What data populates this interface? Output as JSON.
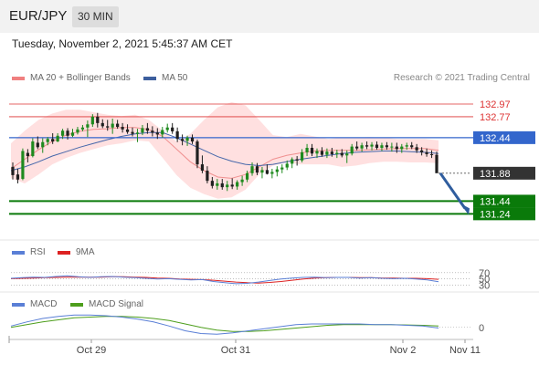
{
  "header": {
    "pair": "EUR/JPY",
    "timeframe": "30 MIN"
  },
  "datetime": "Tuesday, November 2, 2021 5:45:37 AM CET",
  "legend": {
    "ma": "MA 20 + Bollinger Bands",
    "ma50": "MA 50",
    "credit": "Research © 2021 Trading Central"
  },
  "rsi_legend": {
    "rsi": "RSI",
    "ma": "9MA"
  },
  "macd_legend": {
    "macd": "MACD",
    "signal": "MACD Signal"
  },
  "colors": {
    "bullish": "#1e8a1e",
    "bearish": "#1f1f1f",
    "resistance": "#dd3333",
    "support": "#0a7a0a",
    "ma50": "#4466aa",
    "band": "#ffd5d5",
    "pivot": "#3366cc",
    "current": "#333333",
    "arrow": "#2f5d9e"
  },
  "chart_data": {
    "type": "candlestick",
    "ylim": [
      130.9,
      133.2
    ],
    "levels": [
      {
        "value": 132.97,
        "label": "132.97",
        "kind": "resistance"
      },
      {
        "value": 132.77,
        "label": "132.77",
        "kind": "resistance"
      },
      {
        "value": 132.44,
        "label": "132.44",
        "kind": "pivot"
      },
      {
        "value": 131.88,
        "label": "131.88",
        "kind": "current"
      },
      {
        "value": 131.44,
        "label": "131.44",
        "kind": "support"
      },
      {
        "value": 131.24,
        "label": "131.24",
        "kind": "support"
      }
    ],
    "x_ticks": [
      "Oct 29",
      "Oct 31",
      "Nov 2",
      "Nov 11"
    ],
    "rsi_levels": [
      "70",
      "50",
      "30"
    ],
    "macd_levels": [
      "0"
    ],
    "candles": [
      [
        131.98,
        132.05,
        131.78,
        131.85
      ],
      [
        131.86,
        131.95,
        131.72,
        131.78
      ],
      [
        131.79,
        132.27,
        131.77,
        132.23
      ],
      [
        132.2,
        132.26,
        132.05,
        132.15
      ],
      [
        132.15,
        132.43,
        132.13,
        132.38
      ],
      [
        132.36,
        132.46,
        132.26,
        132.29
      ],
      [
        132.29,
        132.43,
        132.2,
        132.37
      ],
      [
        132.37,
        132.45,
        132.32,
        132.42
      ],
      [
        132.42,
        132.51,
        132.34,
        132.38
      ],
      [
        132.38,
        132.51,
        132.37,
        132.47
      ],
      [
        132.47,
        132.58,
        132.42,
        132.55
      ],
      [
        132.55,
        132.59,
        132.41,
        132.47
      ],
      [
        132.47,
        132.58,
        132.45,
        132.52
      ],
      [
        132.52,
        132.61,
        132.49,
        132.57
      ],
      [
        132.57,
        132.64,
        132.54,
        132.6
      ],
      [
        132.6,
        132.71,
        132.45,
        132.65
      ],
      [
        132.65,
        132.81,
        132.61,
        132.77
      ],
      [
        132.77,
        132.83,
        132.6,
        132.67
      ],
      [
        132.67,
        132.73,
        132.59,
        132.62
      ],
      [
        132.62,
        132.72,
        132.55,
        132.6
      ],
      [
        132.6,
        132.74,
        132.5,
        132.66
      ],
      [
        132.66,
        132.72,
        132.58,
        132.61
      ],
      [
        132.61,
        132.67,
        132.52,
        132.57
      ],
      [
        132.57,
        132.65,
        132.5,
        132.53
      ],
      [
        132.53,
        132.6,
        132.46,
        132.5
      ],
      [
        132.5,
        132.58,
        132.37,
        132.52
      ],
      [
        132.52,
        132.64,
        132.48,
        132.59
      ],
      [
        132.59,
        132.67,
        132.5,
        132.55
      ],
      [
        132.55,
        132.62,
        132.46,
        132.52
      ],
      [
        132.52,
        132.59,
        132.42,
        132.49
      ],
      [
        132.49,
        132.61,
        132.44,
        132.56
      ],
      [
        132.56,
        132.66,
        132.52,
        132.6
      ],
      [
        132.6,
        132.67,
        132.5,
        132.54
      ],
      [
        132.54,
        132.6,
        132.37,
        132.42
      ],
      [
        132.42,
        132.49,
        132.32,
        132.39
      ],
      [
        132.39,
        132.47,
        132.31,
        132.44
      ],
      [
        132.44,
        132.49,
        132.34,
        132.38
      ],
      [
        132.38,
        132.41,
        131.96,
        132.02
      ],
      [
        132.02,
        132.16,
        131.88,
        131.92
      ],
      [
        131.92,
        131.99,
        131.72,
        131.76
      ],
      [
        131.76,
        131.82,
        131.64,
        131.68
      ],
      [
        131.68,
        131.79,
        131.62,
        131.72
      ],
      [
        131.72,
        131.79,
        131.62,
        131.66
      ],
      [
        131.66,
        131.76,
        131.6,
        131.7
      ],
      [
        131.7,
        131.8,
        131.63,
        131.67
      ],
      [
        131.67,
        131.77,
        131.62,
        131.74
      ],
      [
        131.74,
        131.84,
        131.68,
        131.78
      ],
      [
        131.78,
        131.92,
        131.74,
        131.88
      ],
      [
        131.88,
        132.05,
        131.84,
        131.99
      ],
      [
        131.99,
        132.04,
        131.85,
        131.89
      ],
      [
        131.89,
        131.98,
        131.8,
        131.93
      ],
      [
        131.93,
        132.02,
        131.86,
        131.87
      ],
      [
        131.87,
        131.95,
        131.8,
        131.9
      ],
      [
        131.9,
        131.99,
        131.83,
        131.94
      ],
      [
        131.94,
        132.02,
        131.88,
        131.97
      ],
      [
        131.97,
        132.08,
        131.93,
        132.03
      ],
      [
        132.03,
        132.13,
        131.96,
        132.1
      ],
      [
        132.1,
        132.15,
        132.0,
        132.08
      ],
      [
        132.08,
        132.26,
        132.05,
        132.21
      ],
      [
        132.21,
        132.34,
        132.15,
        132.28
      ],
      [
        132.28,
        132.34,
        132.15,
        132.19
      ],
      [
        132.19,
        132.27,
        132.12,
        132.23
      ],
      [
        132.23,
        132.29,
        132.14,
        132.17
      ],
      [
        132.17,
        132.27,
        132.12,
        132.22
      ],
      [
        132.22,
        132.28,
        132.14,
        132.18
      ],
      [
        132.18,
        132.25,
        132.12,
        132.2
      ],
      [
        132.2,
        132.26,
        132.13,
        132.16
      ],
      [
        132.16,
        132.24,
        132.04,
        132.19
      ],
      [
        132.19,
        132.34,
        132.16,
        132.3
      ],
      [
        132.3,
        132.38,
        132.24,
        132.27
      ],
      [
        132.27,
        132.36,
        132.22,
        132.32
      ],
      [
        132.32,
        132.38,
        132.26,
        132.3
      ],
      [
        132.3,
        132.37,
        132.24,
        132.33
      ],
      [
        132.33,
        132.38,
        132.25,
        132.28
      ],
      [
        132.28,
        132.36,
        132.23,
        132.32
      ],
      [
        132.32,
        132.37,
        132.25,
        132.29
      ],
      [
        132.29,
        132.36,
        132.22,
        132.3
      ],
      [
        132.3,
        132.36,
        132.2,
        132.26
      ],
      [
        132.26,
        132.34,
        132.2,
        132.3
      ],
      [
        132.3,
        132.36,
        132.25,
        132.32
      ],
      [
        132.32,
        132.37,
        132.26,
        132.29
      ],
      [
        132.29,
        132.34,
        132.2,
        132.24
      ],
      [
        132.24,
        132.29,
        132.16,
        132.21
      ],
      [
        132.21,
        132.27,
        132.14,
        132.18
      ],
      [
        132.18,
        132.24,
        132.12,
        132.17
      ],
      [
        132.17,
        132.22,
        131.9,
        131.88
      ]
    ],
    "bb_upper": [
      132.35,
      132.55,
      132.72,
      132.82,
      132.88,
      132.88,
      132.84,
      132.8,
      132.78,
      132.8,
      132.72,
      132.55,
      132.38,
      132.5,
      132.72,
      132.92,
      133.0,
      132.95,
      132.72,
      132.48,
      132.45,
      132.5,
      132.46,
      132.42,
      132.44,
      132.44,
      132.45,
      132.44,
      132.42,
      132.42,
      132.42,
      132.4
    ],
    "bb_lower": [
      131.8,
      131.72,
      131.86,
      132.02,
      132.12,
      132.2,
      132.26,
      132.32,
      132.35,
      132.4,
      132.38,
      132.12,
      131.85,
      131.65,
      131.55,
      131.48,
      131.5,
      131.62,
      131.86,
      132.0,
      132.05,
      132.02,
      132.02,
      132.02,
      131.98,
      132.0,
      132.04,
      132.06,
      132.06,
      132.05,
      132.05,
      132.04
    ],
    "ma20": [
      131.95,
      132.1,
      132.25,
      132.38,
      132.48,
      132.54,
      132.57,
      132.58,
      132.6,
      132.6,
      132.57,
      132.46,
      132.26,
      132.06,
      131.92,
      131.82,
      131.8,
      131.86,
      131.98,
      132.1,
      132.16,
      132.2,
      132.23,
      132.24,
      132.24,
      132.24,
      132.25,
      132.26,
      132.27,
      132.27,
      132.27,
      132.24
    ],
    "ma50": [
      131.92,
      131.98,
      132.06,
      132.15,
      132.22,
      132.29,
      132.35,
      132.41,
      132.46,
      132.5,
      132.52,
      132.52,
      132.44,
      132.34,
      132.24,
      132.14,
      132.07,
      132.02,
      132.0,
      132.02,
      132.06,
      132.1,
      132.13,
      132.16,
      132.19,
      132.21,
      132.22,
      132.23,
      132.23,
      132.22,
      132.21,
      132.19
    ],
    "rsi": [
      52,
      54,
      56,
      55,
      58,
      60,
      57,
      55,
      57,
      58,
      56,
      54,
      52,
      50,
      51,
      49,
      47,
      48,
      42,
      38,
      35,
      36,
      40,
      45,
      50,
      53,
      55,
      56,
      54,
      55,
      55,
      53,
      54,
      52,
      51,
      52,
      50,
      47,
      41
    ],
    "rsi_ma": [
      51,
      52,
      53,
      54,
      55,
      56,
      56,
      56,
      56,
      57,
      57,
      56,
      55,
      53,
      52,
      50,
      49,
      48,
      46,
      43,
      40,
      38,
      37,
      39,
      42,
      46,
      50,
      53,
      54,
      55,
      55,
      54,
      54,
      53,
      53,
      52,
      52,
      51,
      49
    ],
    "macd": [
      0.02,
      0.08,
      0.13,
      0.16,
      0.18,
      0.18,
      0.17,
      0.15,
      0.12,
      0.08,
      0.02,
      -0.05,
      -0.09,
      -0.1,
      -0.08,
      -0.05,
      -0.02,
      0.01,
      0.04,
      0.05,
      0.05,
      0.05,
      0.05,
      0.04,
      0.04,
      0.03,
      0.02,
      -0.01
    ],
    "macd_signal": [
      0.0,
      0.04,
      0.08,
      0.11,
      0.14,
      0.15,
      0.16,
      0.16,
      0.15,
      0.13,
      0.1,
      0.05,
      0.0,
      -0.04,
      -0.06,
      -0.06,
      -0.05,
      -0.03,
      -0.01,
      0.01,
      0.03,
      0.04,
      0.04,
      0.04,
      0.04,
      0.035,
      0.03,
      0.02
    ]
  }
}
